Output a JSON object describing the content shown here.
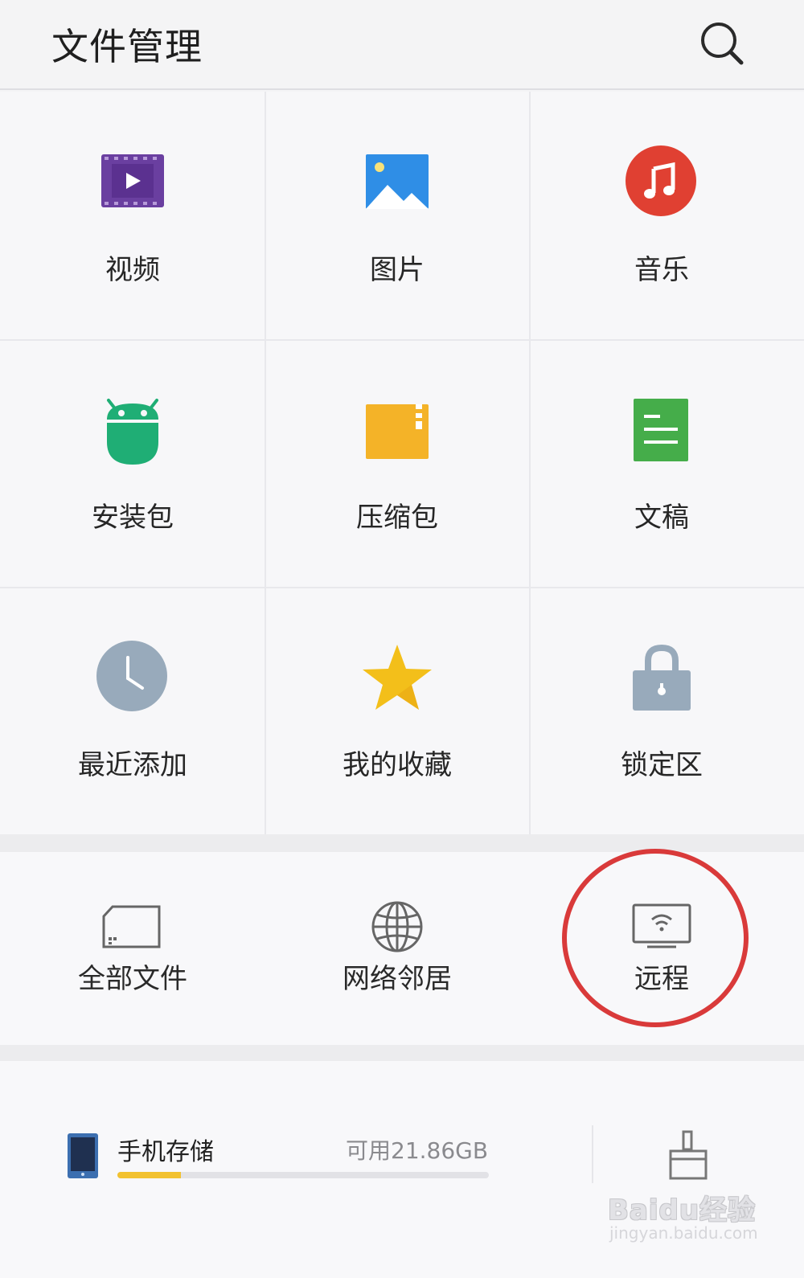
{
  "header": {
    "title": "文件管理",
    "search_icon": "search-icon"
  },
  "categories": [
    {
      "label": "视频",
      "icon": "video-icon",
      "color": "#6a3fa0"
    },
    {
      "label": "图片",
      "icon": "image-icon",
      "color": "#2f8ee6"
    },
    {
      "label": "音乐",
      "icon": "music-icon",
      "color": "#e04032"
    },
    {
      "label": "安装包",
      "icon": "android-icon",
      "color": "#1fae75"
    },
    {
      "label": "压缩包",
      "icon": "zip-icon",
      "color": "#f4b328"
    },
    {
      "label": "文稿",
      "icon": "document-icon",
      "color": "#45ad4a"
    },
    {
      "label": "最近添加",
      "icon": "clock-icon",
      "color": "#98aabb"
    },
    {
      "label": "我的收藏",
      "icon": "star-icon",
      "color": "#f3bf1a"
    },
    {
      "label": "锁定区",
      "icon": "lock-icon",
      "color": "#98aabb"
    }
  ],
  "tools": [
    {
      "label": "全部文件",
      "icon": "sd-card-icon"
    },
    {
      "label": "网络邻居",
      "icon": "globe-icon"
    },
    {
      "label": "远程",
      "icon": "remote-wifi-monitor-icon"
    }
  ],
  "storage": {
    "name": "手机存储",
    "free": "可用21.86GB",
    "used_fraction": 0.17,
    "bar_color": "#f2c230",
    "clean_icon": "broom-icon"
  },
  "annotation": {
    "highlight_color": "#d93a3a"
  },
  "watermark": {
    "text": "Baidu经验",
    "url": "jingyan.baidu.com"
  }
}
